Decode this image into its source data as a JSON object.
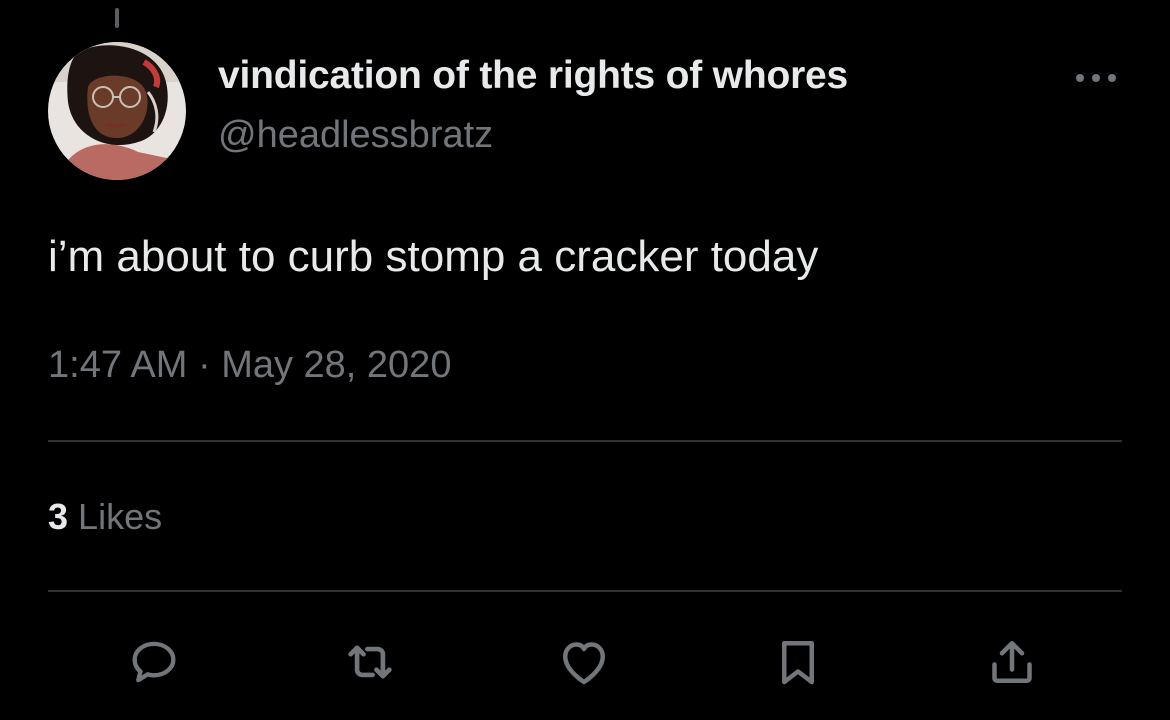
{
  "tweet": {
    "display_name": "vindication of the rights of whores",
    "handle": "@headlessbratz",
    "text": "i’m about to curb stomp a cracker today",
    "timestamp": "1:47 AM · May 28, 2020",
    "likes_count": "3",
    "likes_label": "Likes"
  },
  "icons": {
    "more": "more-options-icon",
    "reply": "reply-icon",
    "retweet": "retweet-icon",
    "like": "heart-icon",
    "bookmark": "bookmark-icon",
    "share": "share-icon"
  },
  "colors": {
    "background": "#000000",
    "primary_text": "#e7e9ea",
    "secondary_text": "#71767b",
    "divider": "#2f3336"
  }
}
